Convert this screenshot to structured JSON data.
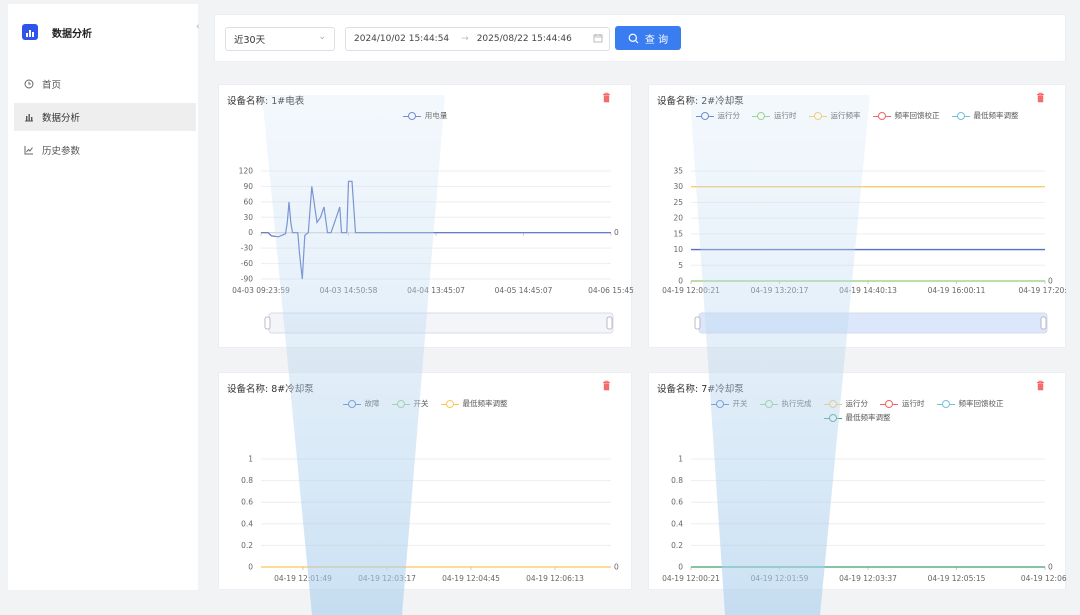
{
  "sidebar": {
    "title": "数据分析",
    "items": [
      {
        "label": "首页",
        "icon": "clock-icon"
      },
      {
        "label": "数据分析",
        "icon": "bar-chart-icon"
      },
      {
        "label": "历史参数",
        "icon": "line-chart-icon"
      }
    ]
  },
  "toolbar": {
    "range_select": "近30天",
    "start": "2024/10/02 15:44:54",
    "separator": "→",
    "end": "2025/08/22 15:44:46",
    "query_label": "查 询"
  },
  "cards": [
    {
      "title": "设备名称: 1#电表"
    },
    {
      "title": "设备名称: 2#冷却泵"
    },
    {
      "title": "设备名称: 8#冷却泵"
    },
    {
      "title": "设备名称: 7#冷却泵"
    }
  ],
  "chart_data": [
    {
      "type": "line",
      "legend": [
        "用电量"
      ],
      "colors": [
        "#5470c6"
      ],
      "x": [
        "04-03 09:23:59",
        "04-03 14:50:58",
        "04-04 13:45:07",
        "04-05 14:45:07",
        "04-06 15:45"
      ],
      "yticks": [
        120,
        90,
        60,
        30,
        0,
        -30,
        -60,
        -90
      ],
      "ylim": [
        -90,
        120
      ],
      "right_label": "0",
      "has_zoom_slider": true
    },
    {
      "type": "line",
      "legend": [
        "运行分",
        "运行时",
        "运行频率",
        "频率回馈校正",
        "最低频率调整"
      ],
      "colors": [
        "#5470c6",
        "#91cc75",
        "#fac858",
        "#ee6666",
        "#73c0de"
      ],
      "x": [
        "04-19 12:00:21",
        "04-19 13:20:17",
        "04-19 14:40:13",
        "04-19 16:00:11",
        "04-19 17:20:0"
      ],
      "yticks": [
        35,
        30,
        25,
        20,
        15,
        10,
        5,
        0
      ],
      "ylim": [
        0,
        35
      ],
      "series": [
        {
          "name": "运行频率",
          "values": [
            30,
            30
          ]
        },
        {
          "name": "运行分",
          "values": [
            10,
            10
          ]
        },
        {
          "name": "运行时",
          "values": [
            0,
            0
          ]
        }
      ],
      "right_label": "0",
      "has_zoom_slider": true
    },
    {
      "type": "line",
      "legend": [
        "故障",
        "开关",
        "最低频率调整"
      ],
      "colors": [
        "#5470c6",
        "#91cc75",
        "#fac858"
      ],
      "x": [
        "04-19 12:01:49",
        "04-19 12:03:17",
        "04-19 12:04:45",
        "04-19 12:06:13"
      ],
      "yticks": [
        1,
        0.8,
        0.6,
        0.4,
        0.2,
        0
      ],
      "ylim": [
        0,
        1
      ],
      "series": [
        {
          "name": "最低频率调整",
          "values": [
            0,
            0
          ]
        }
      ],
      "right_label": "0"
    },
    {
      "type": "line",
      "legend": [
        "开关",
        "执行完成",
        "运行分",
        "运行时",
        "频率回馈校正",
        "最低频率调整"
      ],
      "colors": [
        "#5470c6",
        "#91cc75",
        "#fac858",
        "#ee6666",
        "#73c0de",
        "#3ba272"
      ],
      "x": [
        "04-19 12:00:21",
        "04-19 12:01:59",
        "04-19 12:03:37",
        "04-19 12:05:15",
        "04-19 12:06:"
      ],
      "yticks": [
        1,
        0.8,
        0.6,
        0.4,
        0.2,
        0
      ],
      "ylim": [
        0,
        1
      ],
      "series": [
        {
          "name": "最低频率调整",
          "values": [
            0,
            0
          ]
        }
      ],
      "right_label": "0"
    }
  ]
}
